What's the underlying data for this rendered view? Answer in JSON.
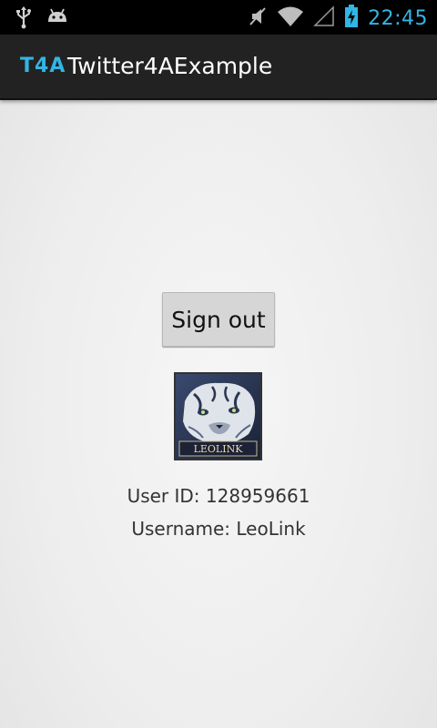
{
  "status_bar": {
    "time": "22:45",
    "left_icons": [
      "usb-icon",
      "android-debug-icon"
    ],
    "right_icons": [
      "vibrate-mute-icon",
      "wifi-icon",
      "signal-icon",
      "battery-charging-icon"
    ],
    "accent_color": "#33b5e5"
  },
  "action_bar": {
    "logo": "T4A",
    "title": "Twitter4AExample"
  },
  "main": {
    "signout_label": "Sign out",
    "avatar_caption": "LEOLINK",
    "user_id": "User ID: 128959661",
    "username": "Username: LeoLink"
  }
}
